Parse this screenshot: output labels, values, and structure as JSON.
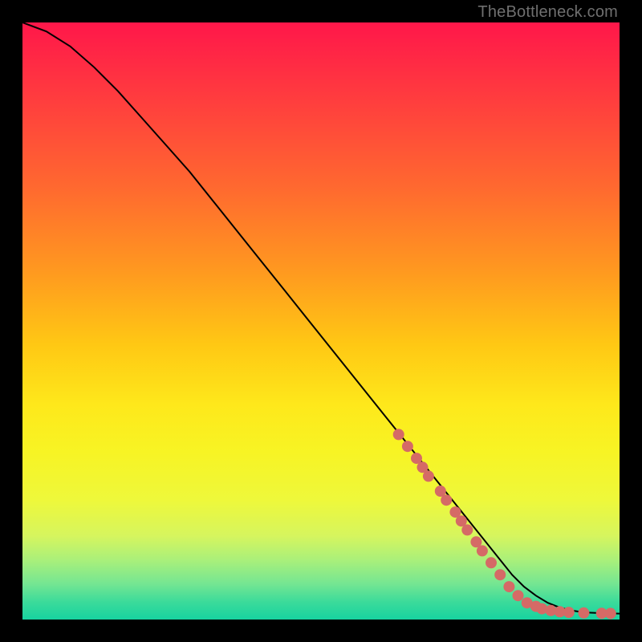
{
  "watermark": "TheBottleneck.com",
  "chart_data": {
    "type": "line",
    "title": "",
    "xlabel": "",
    "ylabel": "",
    "xlim": [
      0,
      100
    ],
    "ylim": [
      0,
      100
    ],
    "series": [
      {
        "name": "curve",
        "x": [
          0,
          4,
          8,
          12,
          16,
          20,
          24,
          28,
          32,
          36,
          40,
          44,
          48,
          52,
          56,
          60,
          64,
          68,
          72,
          76,
          80,
          82,
          84,
          86,
          88,
          90,
          92,
          94,
          96,
          98,
          100
        ],
        "y": [
          100,
          98.5,
          96,
          92.5,
          88.5,
          84,
          79.5,
          75,
          70,
          65,
          60,
          55,
          50,
          45,
          40,
          35,
          30,
          25,
          20,
          15,
          10,
          7.5,
          5.5,
          4,
          2.8,
          2,
          1.5,
          1.2,
          1.1,
          1.05,
          1
        ]
      }
    ],
    "points": [
      {
        "x": 63,
        "y": 31
      },
      {
        "x": 64.5,
        "y": 29
      },
      {
        "x": 66,
        "y": 27
      },
      {
        "x": 67,
        "y": 25.5
      },
      {
        "x": 68,
        "y": 24
      },
      {
        "x": 70,
        "y": 21.5
      },
      {
        "x": 71,
        "y": 20
      },
      {
        "x": 72.5,
        "y": 18
      },
      {
        "x": 73.5,
        "y": 16.5
      },
      {
        "x": 74.5,
        "y": 15
      },
      {
        "x": 76,
        "y": 13
      },
      {
        "x": 77,
        "y": 11.5
      },
      {
        "x": 78.5,
        "y": 9.5
      },
      {
        "x": 80,
        "y": 7.5
      },
      {
        "x": 81.5,
        "y": 5.5
      },
      {
        "x": 83,
        "y": 4
      },
      {
        "x": 84.5,
        "y": 2.8
      },
      {
        "x": 86,
        "y": 2.2
      },
      {
        "x": 87,
        "y": 1.8
      },
      {
        "x": 88.5,
        "y": 1.5
      },
      {
        "x": 90,
        "y": 1.3
      },
      {
        "x": 91.5,
        "y": 1.2
      },
      {
        "x": 94,
        "y": 1.1
      },
      {
        "x": 97,
        "y": 1.05
      },
      {
        "x": 98.5,
        "y": 1.02
      }
    ]
  }
}
